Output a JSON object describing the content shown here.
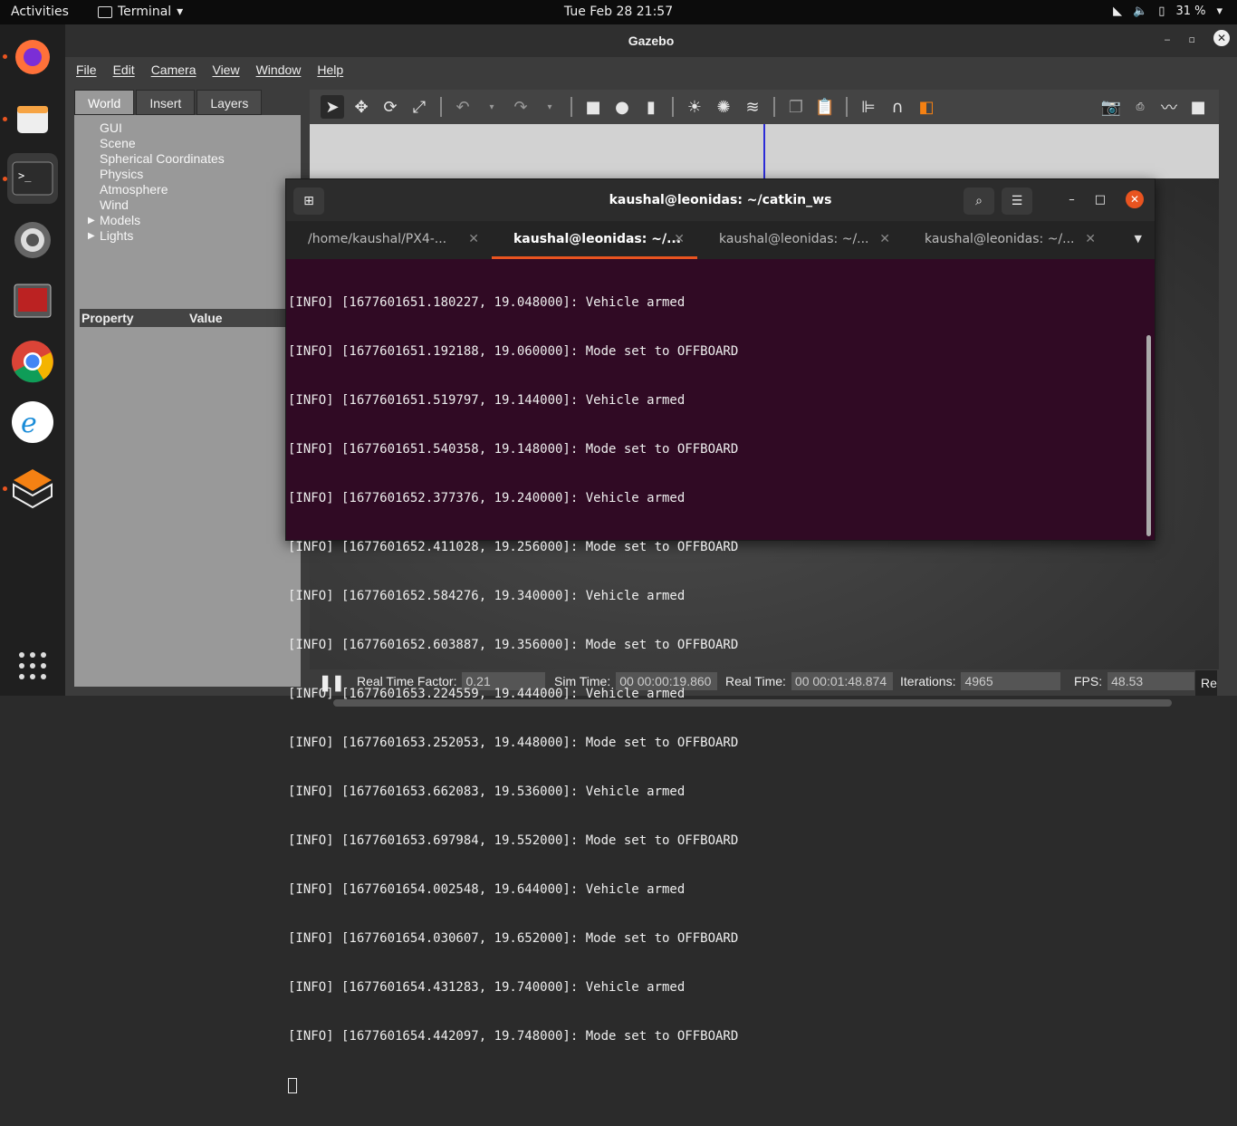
{
  "topbar": {
    "activities": "Activities",
    "app": "Terminal",
    "datetime": "Tue Feb 28  21:57",
    "battery": "31 %"
  },
  "gazebo": {
    "title": "Gazebo",
    "menu": [
      "File",
      "Edit",
      "Camera",
      "View",
      "Window",
      "Help"
    ],
    "tabs": [
      "World",
      "Insert",
      "Layers"
    ],
    "tree": [
      "GUI",
      "Scene",
      "Spherical Coordinates",
      "Physics",
      "Atmosphere",
      "Wind",
      "Models",
      "Lights"
    ],
    "property_header": "Property",
    "value_header": "Value",
    "status": {
      "rtf_label": "Real Time Factor:",
      "rtf": "0.21",
      "sim_label": "Sim Time:",
      "sim": "00 00:00:19.860",
      "real_label": "Real Time:",
      "real": "00 00:01:48.874",
      "iter_label": "Iterations:",
      "iter": "4965",
      "fps_label": "FPS:",
      "fps": "48.53",
      "reset": "Re"
    }
  },
  "terminal": {
    "title": "kaushal@leonidas: ~/catkin_ws",
    "tabs": [
      "/home/kaushal/PX4-...",
      "kaushal@leonidas: ~/...",
      "kaushal@leonidas: ~/...",
      "kaushal@leonidas: ~/..."
    ],
    "lines": [
      "[INFO] [1677601651.180227, 19.048000]: Vehicle armed",
      "[INFO] [1677601651.192188, 19.060000]: Mode set to OFFBOARD",
      "[INFO] [1677601651.519797, 19.144000]: Vehicle armed",
      "[INFO] [1677601651.540358, 19.148000]: Mode set to OFFBOARD",
      "[INFO] [1677601652.377376, 19.240000]: Vehicle armed",
      "[INFO] [1677601652.411028, 19.256000]: Mode set to OFFBOARD",
      "[INFO] [1677601652.584276, 19.340000]: Vehicle armed",
      "[INFO] [1677601652.603887, 19.356000]: Mode set to OFFBOARD",
      "[INFO] [1677601653.224559, 19.444000]: Vehicle armed",
      "[INFO] [1677601653.252053, 19.448000]: Mode set to OFFBOARD",
      "[INFO] [1677601653.662083, 19.536000]: Vehicle armed",
      "[INFO] [1677601653.697984, 19.552000]: Mode set to OFFBOARD",
      "[INFO] [1677601654.002548, 19.644000]: Vehicle armed",
      "[INFO] [1677601654.030607, 19.652000]: Mode set to OFFBOARD",
      "[INFO] [1677601654.431283, 19.740000]: Vehicle armed",
      "[INFO] [1677601654.442097, 19.748000]: Mode set to OFFBOARD"
    ]
  }
}
